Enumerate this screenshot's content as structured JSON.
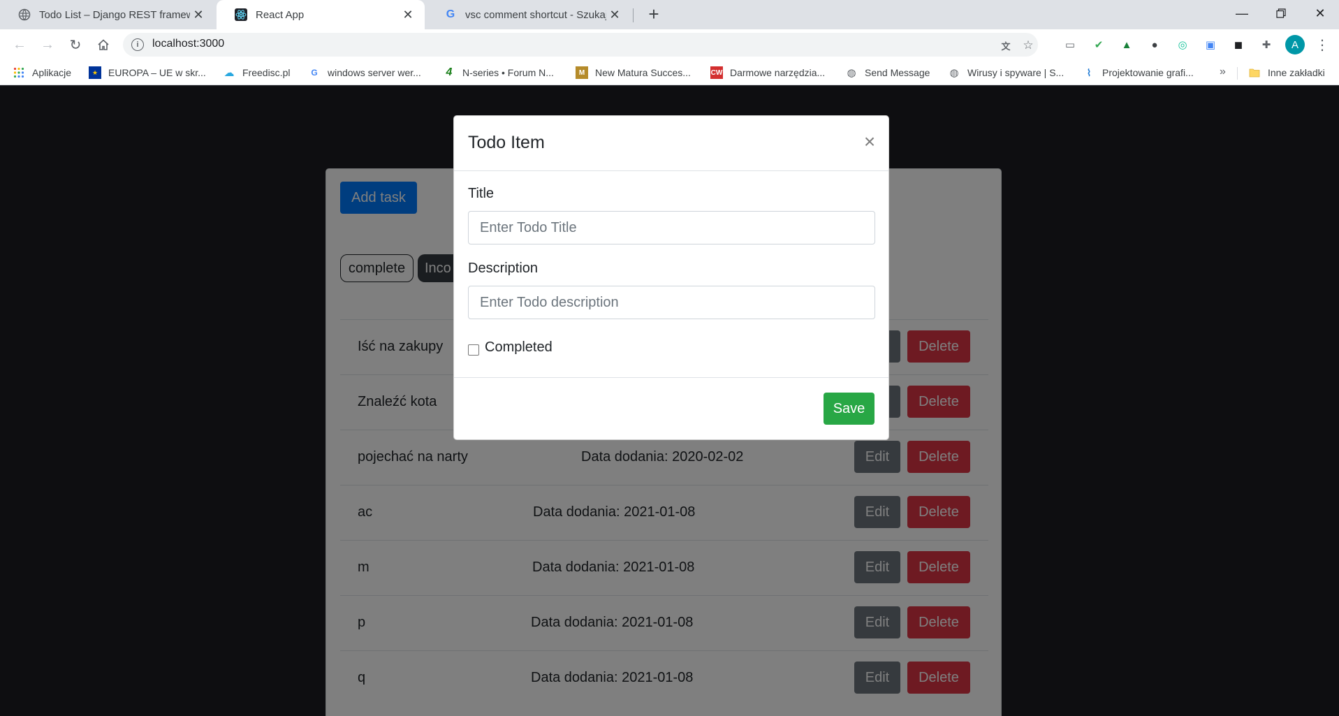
{
  "browser": {
    "tabs": [
      {
        "title": "Todo List – Django REST framewo"
      },
      {
        "title": "React App"
      },
      {
        "title": "vsc comment shortcut - Szukaj w"
      }
    ],
    "url": "localhost:3000",
    "avatar_letter": "A",
    "bookmarks": [
      {
        "label": "Aplikacje"
      },
      {
        "label": "EUROPA – UE w skr..."
      },
      {
        "label": "Freedisc.pl"
      },
      {
        "label": "windows server wer..."
      },
      {
        "label": "N-series • Forum N..."
      },
      {
        "label": "New Matura Succes..."
      },
      {
        "label": "Darmowe narzędzia..."
      },
      {
        "label": "Send Message"
      },
      {
        "label": "Wirusy i spyware | S..."
      },
      {
        "label": "Projektowanie grafi..."
      },
      {
        "label": "Inne zakładki"
      }
    ],
    "bookmarks_overflow": "»"
  },
  "app": {
    "add_task_label": "Add task",
    "filter_tabs": [
      {
        "label": "complete"
      },
      {
        "label": "Inco"
      }
    ],
    "todos": [
      {
        "title": "Iść na zakupy",
        "date": ""
      },
      {
        "title": "Znaleźć kota",
        "date": ""
      },
      {
        "title": "pojechać na narty",
        "date": "Data dodania: 2020-02-02"
      },
      {
        "title": "ac",
        "date": "Data dodania: 2021-01-08"
      },
      {
        "title": "m",
        "date": "Data dodania: 2021-01-08"
      },
      {
        "title": "p",
        "date": "Data dodania: 2021-01-08"
      },
      {
        "title": "q",
        "date": "Data dodania: 2021-01-08"
      }
    ],
    "edit_label": "Edit",
    "delete_label": "Delete"
  },
  "modal": {
    "title": "Todo Item",
    "close_glyph": "×",
    "title_label": "Title",
    "title_placeholder": "Enter Todo Title",
    "description_label": "Description",
    "description_placeholder": "Enter Todo description",
    "completed_label": "Completed",
    "save_label": "Save"
  }
}
